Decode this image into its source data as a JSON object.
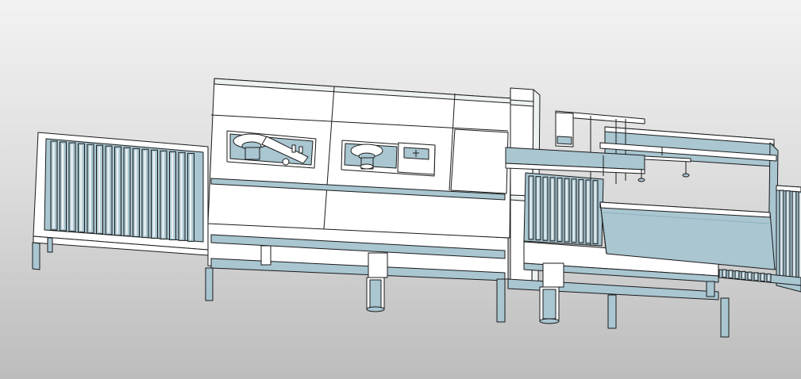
{
  "viewport": {
    "background_top": "#f2f2f2",
    "background_bottom": "#bcbcbc"
  },
  "model": {
    "colors": {
      "panel": "#ffffff",
      "panel_shade": "#eef1f2",
      "steel": "#a9c6d1",
      "steel_dark": "#8fb1be",
      "edge": "#1a1a1a"
    },
    "components": [
      "infeed-roller-conveyor",
      "main-machine-cabinet",
      "spindle-window-left",
      "spindle-window-right",
      "control-box",
      "machine-base-frame",
      "gantry-column",
      "transfer-gantry",
      "outfeed-roller-conveyor",
      "outfeed-hopper",
      "outfeed-frame",
      "exit-roller-conveyor"
    ]
  }
}
